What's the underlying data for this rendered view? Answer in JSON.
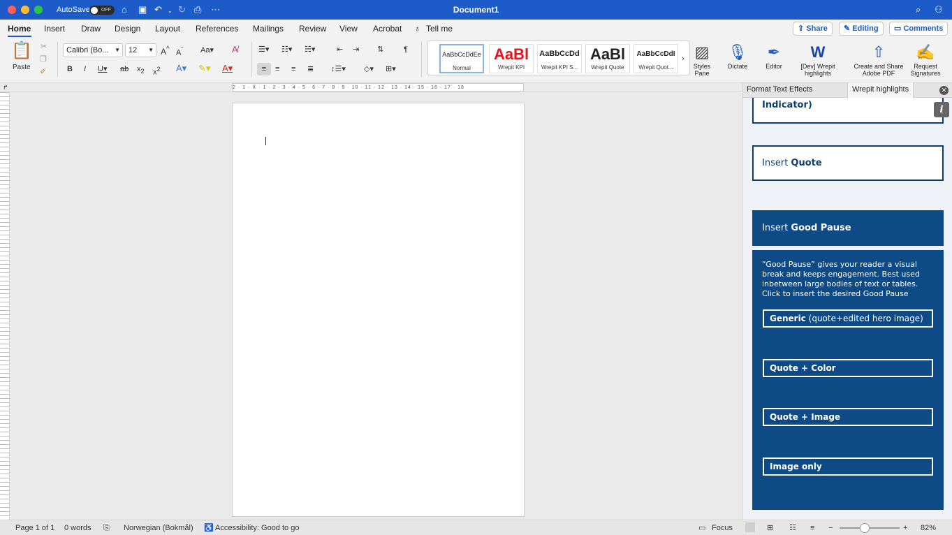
{
  "titlebar": {
    "autosave_label": "AutoSave",
    "autosave_state": "OFF",
    "document_title": "Document1"
  },
  "tabs": [
    "Home",
    "Insert",
    "Draw",
    "Design",
    "Layout",
    "References",
    "Mailings",
    "Review",
    "View",
    "Acrobat"
  ],
  "tell_me": "Tell me",
  "top_buttons": {
    "share": "Share",
    "editing": "Editing",
    "comments": "Comments"
  },
  "ribbon": {
    "paste": "Paste",
    "font_name": "Calibri (Bo...",
    "font_size": "12",
    "styles": [
      {
        "preview": "AaBbCcDdEe",
        "name": "Normal"
      },
      {
        "preview": "AaBl",
        "name": "Wrepit KPI"
      },
      {
        "preview": "AaBbCcDd",
        "name": "Wrepit KPI S..."
      },
      {
        "preview": "AaBl",
        "name": "Wrepit Quote"
      },
      {
        "preview": "AaBbCcDdI",
        "name": "Wrepit Quot..."
      }
    ],
    "styles_pane": "Styles Pane",
    "dictate": "Dictate",
    "editor": "Editor",
    "dev_highlights": "[Dev] Wrepit highlights",
    "create_share_pdf": "Create and Share Adobe PDF",
    "request_signatures": "Request Signatures"
  },
  "ruler_numbers": "2 · 1 · ⊼ · 1 · 2 · 3 · 4 · 5 · 6 · 7 · 8 · 9 · 10 · 11 · 12 · 13 · 14 · 15 · 16 · 17 · 18",
  "pane": {
    "tab_format": "Format Text Effects",
    "tab_wrepit": "Wrepit highlights",
    "top_card_text": "Indicator)",
    "insert_quote_prefix": "Insert ",
    "insert_quote_bold": "Quote",
    "insert_gp_prefix": "Insert ",
    "insert_gp_bold": "Good Pause",
    "gp_description": "“Good Pause” gives your reader a visual break and keeps engagement. Best used inbetween large bodies of text or tables. Click to insert the desired Good Pause",
    "gp_buttons": [
      {
        "bold": "Generic",
        "rest": " (quote+edited hero image)"
      },
      {
        "bold": "Quote + Color",
        "rest": ""
      },
      {
        "bold": "Quote + Image",
        "rest": ""
      },
      {
        "bold": "Image only",
        "rest": ""
      }
    ]
  },
  "status": {
    "page": "Page 1 of 1",
    "words": "0 words",
    "language": "Norwegian (Bokmål)",
    "accessibility": "Accessibility: Good to go",
    "focus": "Focus",
    "zoom": "82%"
  },
  "colors": {
    "titlebar": "#1d5cc8",
    "pane_dark": "#0e4a86",
    "pane_text": "#0e3f74"
  }
}
